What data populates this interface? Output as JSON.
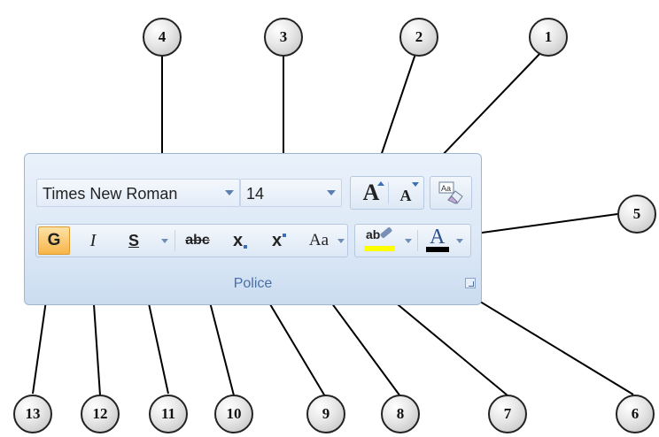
{
  "font_group": {
    "label": "Police",
    "font_name": "Times New Roman",
    "font_size": "14",
    "bold_label": "G",
    "italic_label": "I",
    "underline_label": "S",
    "strikethrough_label": "abc",
    "subscript_label": "x",
    "superscript_label": "x",
    "change_case_label": "Aa",
    "grow_font_label": "A",
    "shrink_font_label": "A",
    "highlight_label": "ab",
    "font_color_label": "A",
    "font_color": "#000000",
    "highlight_color": "#ffff00",
    "bold_active_color": "#f7b54a"
  },
  "callouts": [
    "1",
    "2",
    "3",
    "4",
    "5",
    "6",
    "7",
    "8",
    "9",
    "10",
    "11",
    "12",
    "13"
  ]
}
